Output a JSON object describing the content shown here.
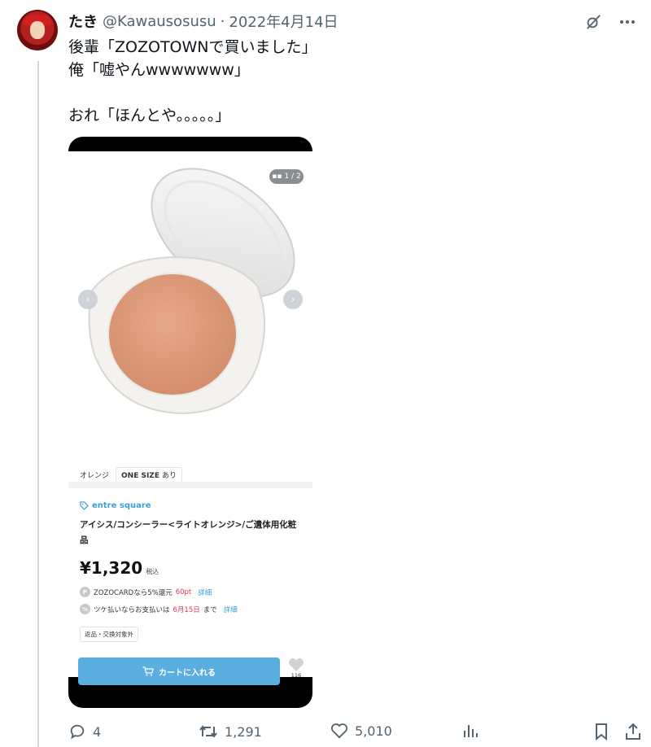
{
  "author": {
    "display_name": "たき",
    "handle": "@Kawausosusu",
    "separator": "·",
    "date": "2022年4月14日"
  },
  "tweet_lines": [
    "後輩「ZOZOTOWNで買いました」",
    "俺「嘘やんwwwwwww」",
    "",
    "おれ「ほんとや。。。。。」"
  ],
  "screenshot": {
    "image_counter": "1 / 2",
    "color_label": "オレンジ",
    "size_label": "ONE SIZE",
    "stock_label": "あり",
    "brand": "entre square",
    "product_name": "アイシス/コンシーラー<ライトオレンジ>/ご遺体用化粧品",
    "price": "¥1,320",
    "tax_label": "税込",
    "point_line_1_pre": "ZOZOCARDなら5%還元",
    "point_line_1_hl": "60pt",
    "point_line_1_link": "詳細",
    "point_line_2_pre": "ツケ払いならお支払いは",
    "point_line_2_hl": "6月15日",
    "point_line_2_post": "まで",
    "point_line_2_link": "詳細",
    "return_tag": "返品・交換対象外",
    "cart_label": "カートに入れる",
    "fav_count": "116"
  },
  "actions": {
    "replies": "4",
    "retweets": "1,291",
    "likes": "5,010"
  },
  "colors": {
    "secondary_text": "#536471",
    "cart_blue": "#5aaee0",
    "brand_blue": "#3a9fd8",
    "highlight_red": "#e0365a"
  }
}
